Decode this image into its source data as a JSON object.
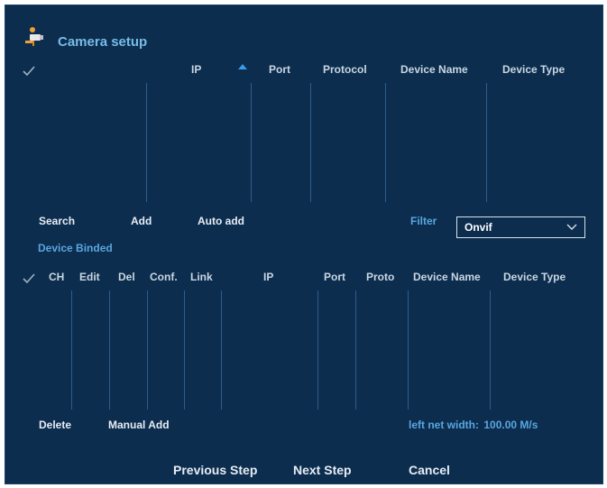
{
  "window": {
    "title": "Camera setup",
    "icon": "camera-setup-icon"
  },
  "search_table": {
    "headers": {
      "ip": "IP",
      "port": "Port",
      "protocol": "Protocol",
      "device_name": "Device Name",
      "device_type": "Device Type"
    },
    "sort": {
      "column": "ip",
      "direction": "ascending"
    },
    "rows": []
  },
  "search_actions": {
    "search": "Search",
    "add": "Add",
    "auto_add": "Auto add"
  },
  "filter": {
    "label": "Filter",
    "value": "Onvif"
  },
  "binded": {
    "section_label": "Device Binded",
    "headers": {
      "ch": "CH",
      "edit": "Edit",
      "del": "Del",
      "conf": "Conf.",
      "link": "Link",
      "ip": "IP",
      "port": "Port",
      "proto": "Proto",
      "device_name": "Device Name",
      "device_type": "Device Type"
    },
    "rows": []
  },
  "binded_actions": {
    "delete": "Delete",
    "manual_add": "Manual Add"
  },
  "bandwidth": {
    "label": "left net width:",
    "value": "100.00 M/s"
  },
  "footer": {
    "previous": "Previous Step",
    "next": "Next Step",
    "cancel": "Cancel"
  },
  "colors": {
    "panel_bg": "#0c2d4e",
    "accent": "#5aa6e0",
    "title": "#78bce8",
    "text": "#e6edf5"
  }
}
